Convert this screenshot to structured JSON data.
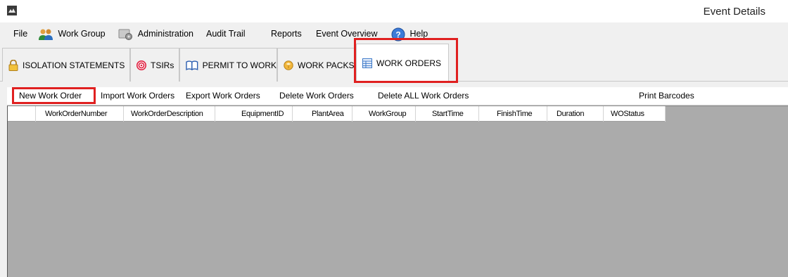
{
  "window": {
    "title": "Event Details",
    "app_icon": "app-logo-icon"
  },
  "menu": {
    "items": [
      {
        "label": "File",
        "icon": null
      },
      {
        "label": "Work Group",
        "icon": "users-icon"
      },
      {
        "label": "Administration",
        "icon": "admin-icon"
      },
      {
        "label": "Audit Trail",
        "icon": null
      },
      {
        "label": "Reports",
        "icon": null
      },
      {
        "label": "Event Overview",
        "icon": null
      },
      {
        "label": "Help",
        "icon": "help-icon"
      }
    ]
  },
  "tabs": {
    "items": [
      {
        "label": "ISOLATION STATEMENTS",
        "icon": "lock-icon",
        "active": false
      },
      {
        "label": "TSIRs",
        "icon": "target-icon",
        "active": false
      },
      {
        "label": "PERMIT TO WORK",
        "icon": "book-icon",
        "active": false
      },
      {
        "label": "WORK PACKS",
        "icon": "package-icon",
        "active": false
      },
      {
        "label": "WORK ORDERS",
        "icon": "table-icon",
        "active": true
      }
    ]
  },
  "toolbar": {
    "new_work_order": "New Work Order",
    "import_work_orders": "Import Work Orders",
    "export_work_orders": "Export Work Orders",
    "delete_work_orders": "Delete Work Orders",
    "delete_all_work_orders": "Delete ALL Work Orders",
    "print_barcodes": "Print Barcodes"
  },
  "grid": {
    "columns": [
      "WorkOrderNumber",
      "WorkOrderDescription",
      "EquipmentID",
      "PlantArea",
      "WorkGroup",
      "StartTime",
      "FinishTime",
      "Duration",
      "WOStatus"
    ],
    "rows": []
  },
  "colors": {
    "highlight": "#e02020",
    "grid_background": "#ababab",
    "window_background": "#f0f0f0"
  }
}
